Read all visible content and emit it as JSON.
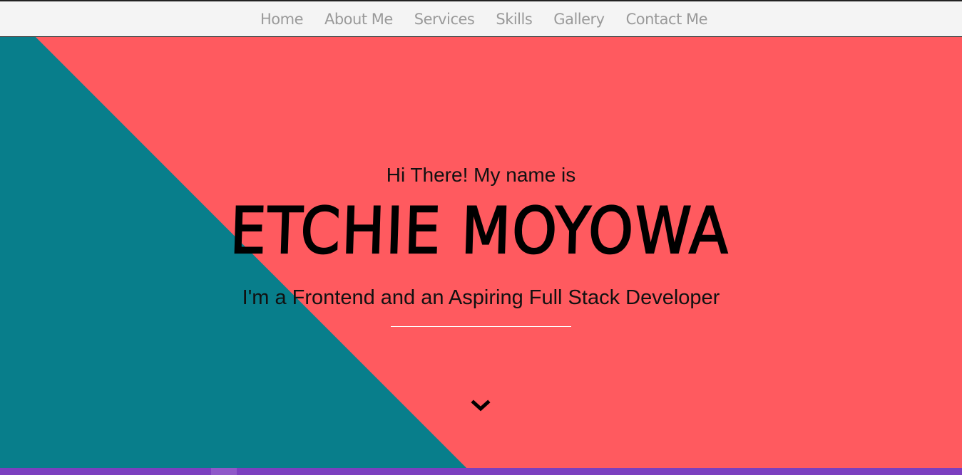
{
  "navbar": {
    "items": [
      {
        "label": "Home"
      },
      {
        "label": "About Me"
      },
      {
        "label": "Services"
      },
      {
        "label": "Skills"
      },
      {
        "label": "Gallery"
      },
      {
        "label": "Contact Me"
      }
    ]
  },
  "hero": {
    "greeting": "Hi There! My name is",
    "name": "ETCHIE MOYOWA",
    "tagline": "I'm a Frontend and an Aspiring Full Stack Developer",
    "scroll_icon": "chevron-down-icon"
  },
  "colors": {
    "hero_background": "#ff5a5f",
    "hero_accent": "#087e8b",
    "nav_background": "#f4f4f4",
    "nav_text": "#9a9a9a",
    "footer_bar": "#7b3fbf"
  }
}
